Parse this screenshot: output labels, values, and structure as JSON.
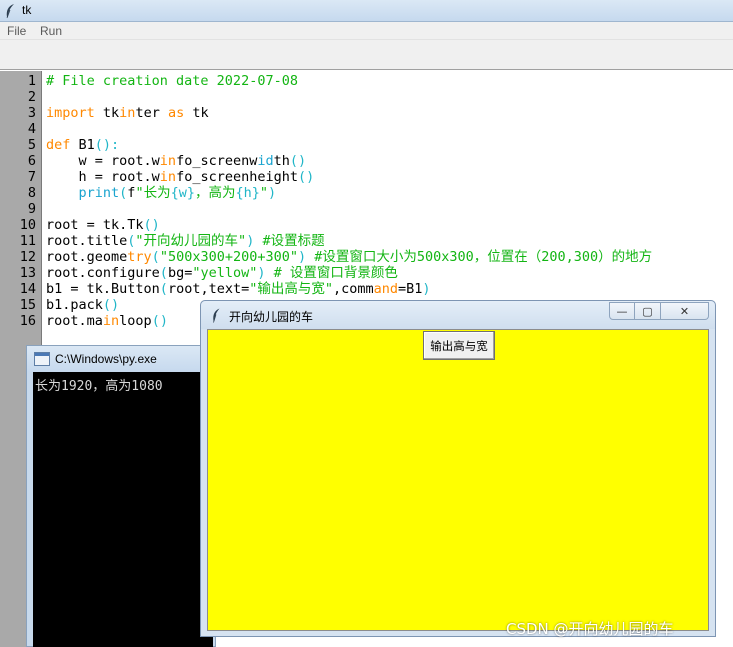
{
  "main_window": {
    "title": "tk",
    "menu": [
      "File",
      "Run"
    ]
  },
  "editor": {
    "line_numbers": [
      "1",
      "2",
      "3",
      "4",
      "5",
      "6",
      "7",
      "8",
      "9",
      "10",
      "11",
      "12",
      "13",
      "14",
      "15",
      "16"
    ],
    "lines": [
      [
        {
          "t": "# File creation date 2022-07-08",
          "c": "cm"
        }
      ],
      [],
      [
        {
          "t": "import",
          "c": "kw"
        },
        {
          "t": " tk"
        },
        {
          "t": "in",
          "c": "kw"
        },
        {
          "t": "ter "
        },
        {
          "t": "as",
          "c": "kw"
        },
        {
          "t": " tk"
        }
      ],
      [],
      [
        {
          "t": "def",
          "c": "kw"
        },
        {
          "t": " B1"
        },
        {
          "t": "():",
          "c": "pa"
        }
      ],
      [
        {
          "t": "    w = root.w"
        },
        {
          "t": "in",
          "c": "kw"
        },
        {
          "t": "fo_screenw"
        },
        {
          "t": "id",
          "c": "bi"
        },
        {
          "t": "th"
        },
        {
          "t": "()",
          "c": "pa"
        }
      ],
      [
        {
          "t": "    h = root.w"
        },
        {
          "t": "in",
          "c": "kw"
        },
        {
          "t": "fo_screenheight"
        },
        {
          "t": "()",
          "c": "pa"
        }
      ],
      [
        {
          "t": "    "
        },
        {
          "t": "print",
          "c": "bi"
        },
        {
          "t": "(",
          "c": "pa"
        },
        {
          "t": "f"
        },
        {
          "t": "\"长为",
          "c": "st"
        },
        {
          "t": "{w}",
          "c": "pa"
        },
        {
          "t": "，高为",
          "c": "st"
        },
        {
          "t": "{h}",
          "c": "pa"
        },
        {
          "t": "\"",
          "c": "st"
        },
        {
          "t": ")",
          "c": "pa"
        }
      ],
      [],
      [
        {
          "t": "root = tk.Tk"
        },
        {
          "t": "()",
          "c": "pa"
        }
      ],
      [
        {
          "t": "root.title"
        },
        {
          "t": "(",
          "c": "pa"
        },
        {
          "t": "\"开向幼儿园的车\"",
          "c": "st"
        },
        {
          "t": ")",
          "c": "pa"
        },
        {
          "t": " #设置标题",
          "c": "cm"
        }
      ],
      [
        {
          "t": "root.geome"
        },
        {
          "t": "try",
          "c": "kw"
        },
        {
          "t": "(",
          "c": "pa"
        },
        {
          "t": "\"500x300+200+300\"",
          "c": "st"
        },
        {
          "t": ")",
          "c": "pa"
        },
        {
          "t": " #设置窗口大小为500x300，位置在（200,300）的地方",
          "c": "cm"
        }
      ],
      [
        {
          "t": "root.configure"
        },
        {
          "t": "(",
          "c": "pa"
        },
        {
          "t": "bg="
        },
        {
          "t": "\"yellow\"",
          "c": "st"
        },
        {
          "t": ")",
          "c": "pa"
        },
        {
          "t": " # 设置窗口背景颜色",
          "c": "cm"
        }
      ],
      [
        {
          "t": "b1 = tk.Button"
        },
        {
          "t": "(",
          "c": "pa"
        },
        {
          "t": "root,text="
        },
        {
          "t": "\"输出高与宽\"",
          "c": "st"
        },
        {
          "t": ",comm"
        },
        {
          "t": "and",
          "c": "kw"
        },
        {
          "t": "=B1"
        },
        {
          "t": ")",
          "c": "pa"
        }
      ],
      [
        {
          "t": "b1.pack"
        },
        {
          "t": "()",
          "c": "pa"
        }
      ],
      [
        {
          "t": "root.ma"
        },
        {
          "t": "in",
          "c": "kw"
        },
        {
          "t": "loop"
        },
        {
          "t": "()",
          "c": "pa"
        }
      ]
    ]
  },
  "console": {
    "title": "C:\\Windows\\py.exe",
    "output": "长为1920，高为1080"
  },
  "tk_window": {
    "title": "开向幼儿园的车",
    "minimize_glyph": "—",
    "maximize_glyph": "▢",
    "close_glyph": "✕",
    "button_label": "输出高与宽",
    "background_color": "#ffff00"
  },
  "watermark": "CSDN @开向幼儿园的车"
}
